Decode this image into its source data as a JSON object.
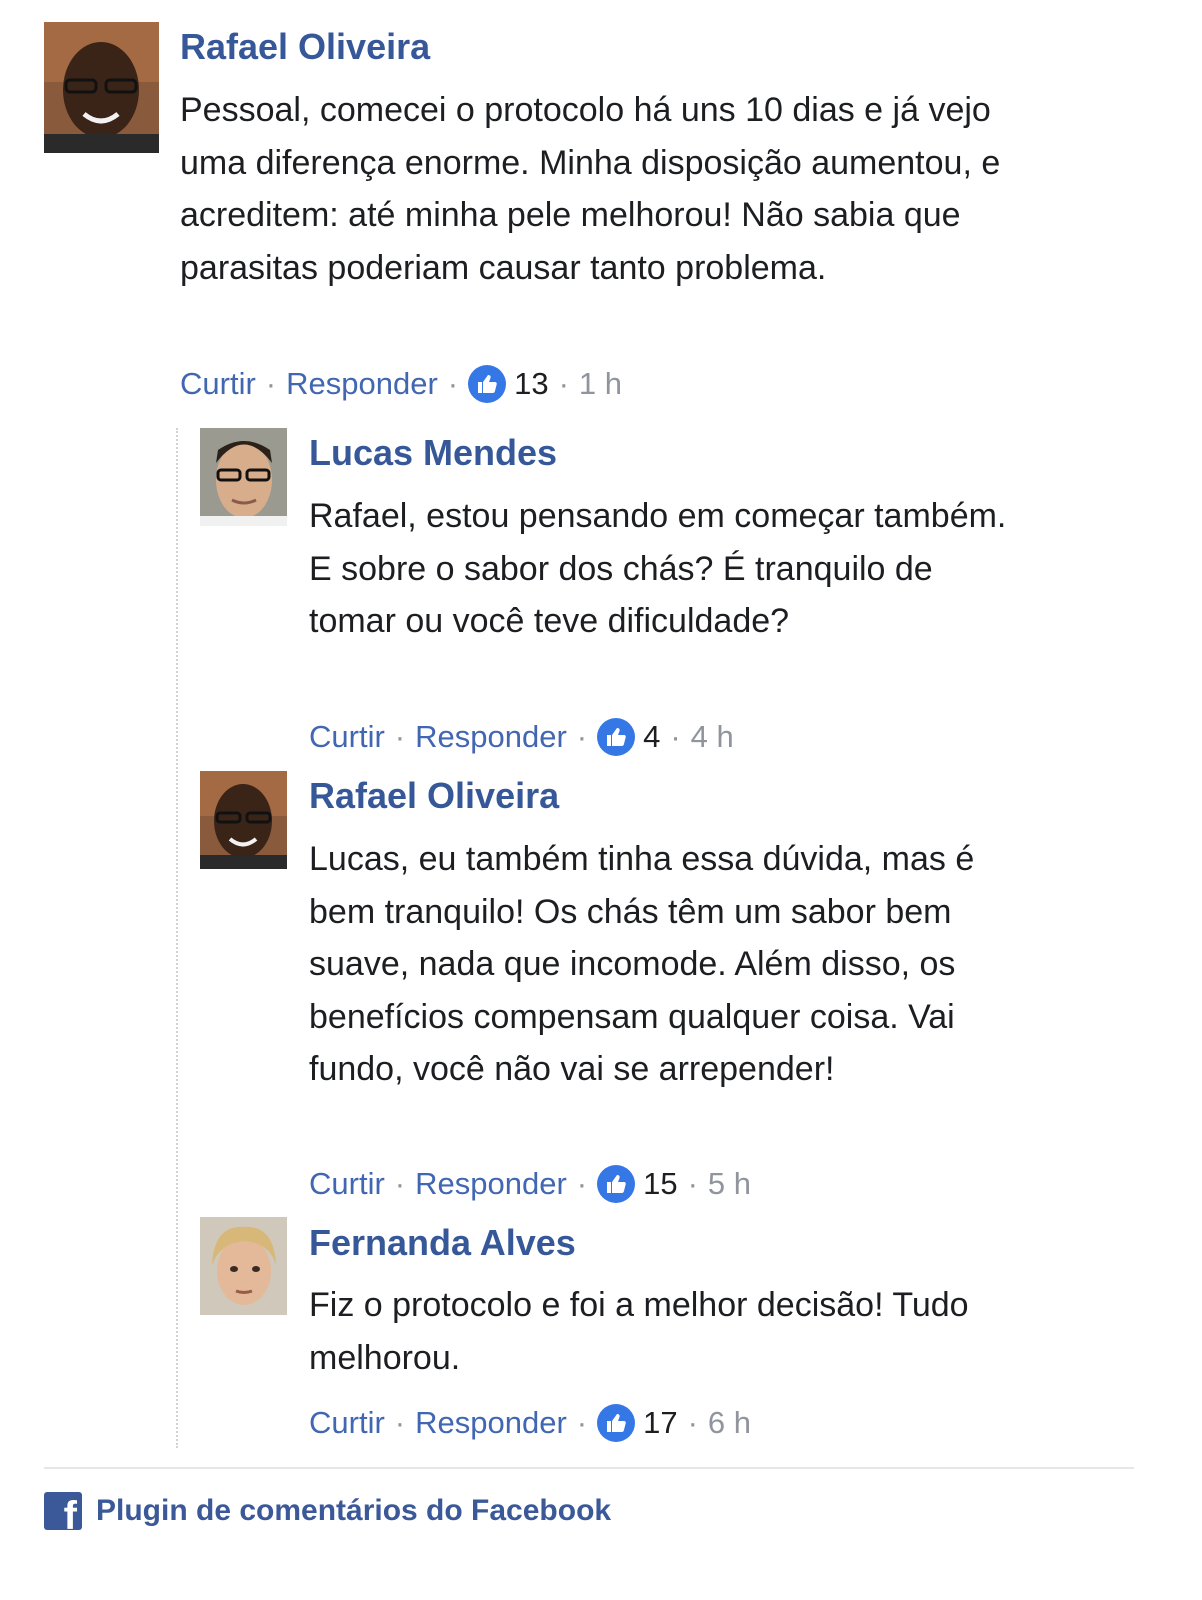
{
  "comments": [
    {
      "author": "Rafael Oliveira",
      "text": "Pessoal, comecei o protocolo há uns 10 dias e já vejo uma diferença enorme. Minha disposição aumentou, e acreditem: até minha pele melhorou! Não sabia que parasitas poderiam causar tanto problema.",
      "like_label": "Curtir",
      "reply_label": "Responder",
      "likes": "13",
      "time": "1 h"
    }
  ],
  "replies": [
    {
      "author": "Lucas Mendes",
      "text": "Rafael, estou pensando em começar também. E sobre o sabor dos chás? É tranquilo de tomar ou você teve dificuldade?",
      "like_label": "Curtir",
      "reply_label": "Responder",
      "likes": "4",
      "time": "4 h"
    },
    {
      "author": "Rafael Oliveira",
      "text": "Lucas, eu também tinha essa dúvida, mas é bem tranquilo! Os chás têm um sabor bem suave, nada que incomode. Além disso, os benefícios compensam qualquer coisa. Vai fundo, você não vai se arrepender!",
      "like_label": "Curtir",
      "reply_label": "Responder",
      "likes": "15",
      "time": "5 h"
    },
    {
      "author": "Fernanda Alves",
      "text": "Fiz o protocolo e foi a melhor decisão! Tudo melhorou.",
      "like_label": "Curtir",
      "reply_label": "Responder",
      "likes": "17",
      "time": "6 h"
    }
  ],
  "separator": "·",
  "footer": {
    "label": "Plugin de comentários do Facebook",
    "logo_letter": "f"
  },
  "colors": {
    "link": "#365899",
    "action": "#4267b2",
    "like_badge": "#3578e5",
    "meta": "#90949c",
    "facebook": "#3b5998"
  }
}
